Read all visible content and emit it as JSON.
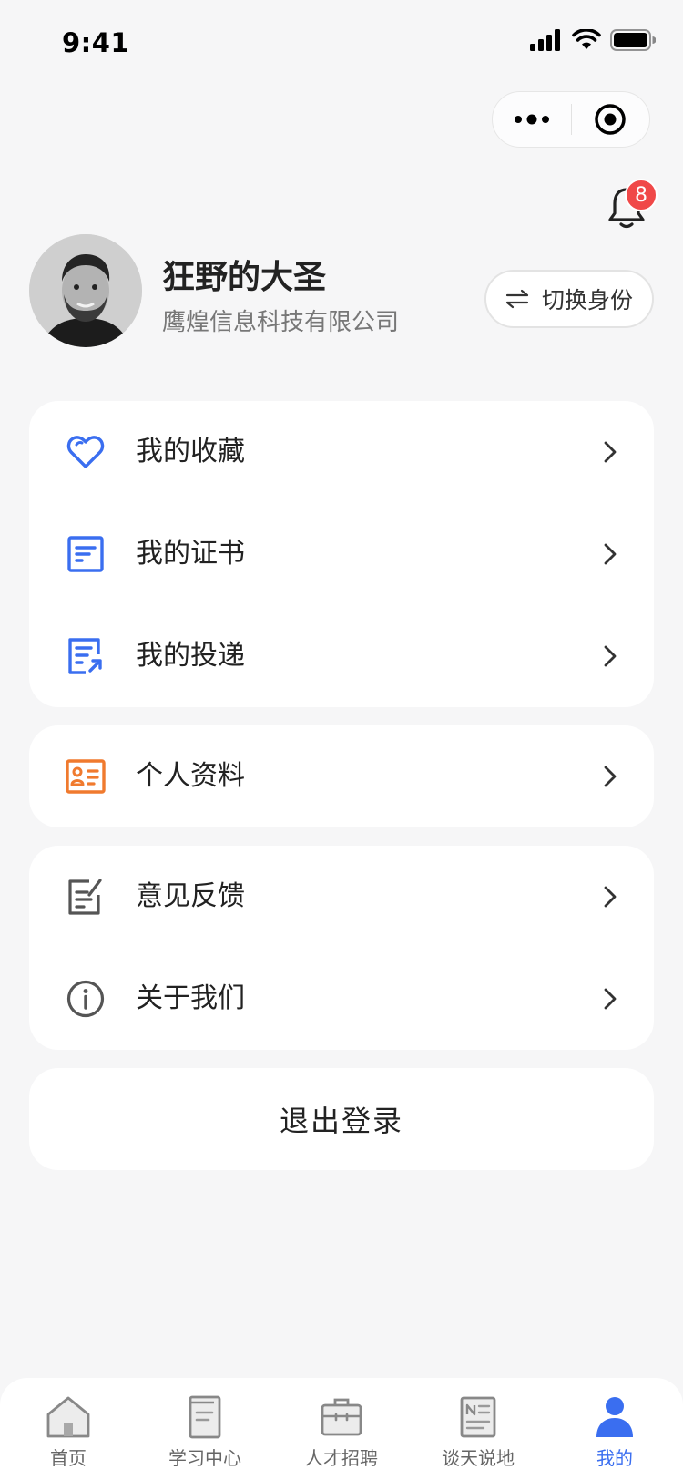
{
  "status_bar": {
    "time": "9:41"
  },
  "notifications": {
    "badge_count": "8"
  },
  "profile": {
    "name": "狂野的大圣",
    "company": "鹰煌信息科技有限公司",
    "switch_label": "切换身份"
  },
  "menu_group_1": [
    {
      "label": "我的收藏",
      "icon": "heart-icon"
    },
    {
      "label": "我的证书",
      "icon": "certificate-icon"
    },
    {
      "label": "我的投递",
      "icon": "resume-submit-icon"
    }
  ],
  "menu_group_2": [
    {
      "label": "个人资料",
      "icon": "id-card-icon"
    }
  ],
  "menu_group_3": [
    {
      "label": "意见反馈",
      "icon": "feedback-icon"
    },
    {
      "label": "关于我们",
      "icon": "info-icon"
    }
  ],
  "logout_label": "退出登录",
  "tabs": [
    {
      "label": "首页",
      "icon": "home-icon"
    },
    {
      "label": "学习中心",
      "icon": "book-icon"
    },
    {
      "label": "人才招聘",
      "icon": "briefcase-icon"
    },
    {
      "label": "谈天说地",
      "icon": "news-icon"
    },
    {
      "label": "我的",
      "icon": "user-icon",
      "active": true
    }
  ],
  "colors": {
    "accent": "#3a6ef0",
    "orange": "#f07a2e",
    "badge": "#f04848",
    "background": "#f6f6f7"
  }
}
